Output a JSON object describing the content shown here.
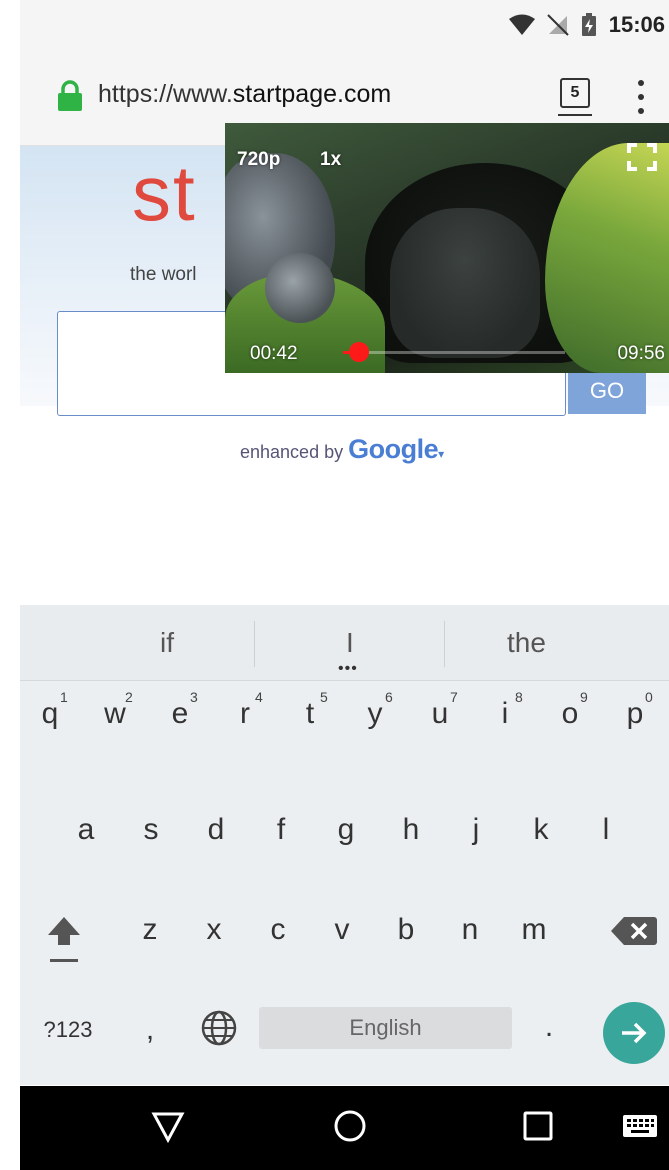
{
  "status_bar": {
    "time": "15:06"
  },
  "url_bar": {
    "url_prefix": "https://www.",
    "url_host": "startpage.com",
    "tab_count": "5"
  },
  "page": {
    "logo_text": "st",
    "tagline": "the worl",
    "go_label": "GO",
    "enhanced_prefix": "enhanced by",
    "enhanced_brand": "Google",
    "enhanced_caret": "▾"
  },
  "video": {
    "quality": "720p",
    "speed": "1x",
    "current_time": "00:42",
    "total_time": "09:56",
    "progress_fraction": 0.07
  },
  "keyboard": {
    "suggestions": [
      "if",
      "I",
      "the"
    ],
    "row1": [
      {
        "key": "q",
        "hint": "1"
      },
      {
        "key": "w",
        "hint": "2"
      },
      {
        "key": "e",
        "hint": "3"
      },
      {
        "key": "r",
        "hint": "4"
      },
      {
        "key": "t",
        "hint": "5"
      },
      {
        "key": "y",
        "hint": "6"
      },
      {
        "key": "u",
        "hint": "7"
      },
      {
        "key": "i",
        "hint": "8"
      },
      {
        "key": "o",
        "hint": "9"
      },
      {
        "key": "p",
        "hint": "0"
      }
    ],
    "row2": [
      "a",
      "s",
      "d",
      "f",
      "g",
      "h",
      "j",
      "k",
      "l"
    ],
    "row3": [
      "z",
      "x",
      "c",
      "v",
      "b",
      "n",
      "m"
    ],
    "symbols_label": "?123",
    "comma_label": ",",
    "space_label": "English",
    "period_label": "."
  },
  "colors": {
    "accent_logo": "#e0493d",
    "lock_green": "#2fb344",
    "progress_red": "#ff1a1a",
    "enter_teal": "#38a69a"
  }
}
